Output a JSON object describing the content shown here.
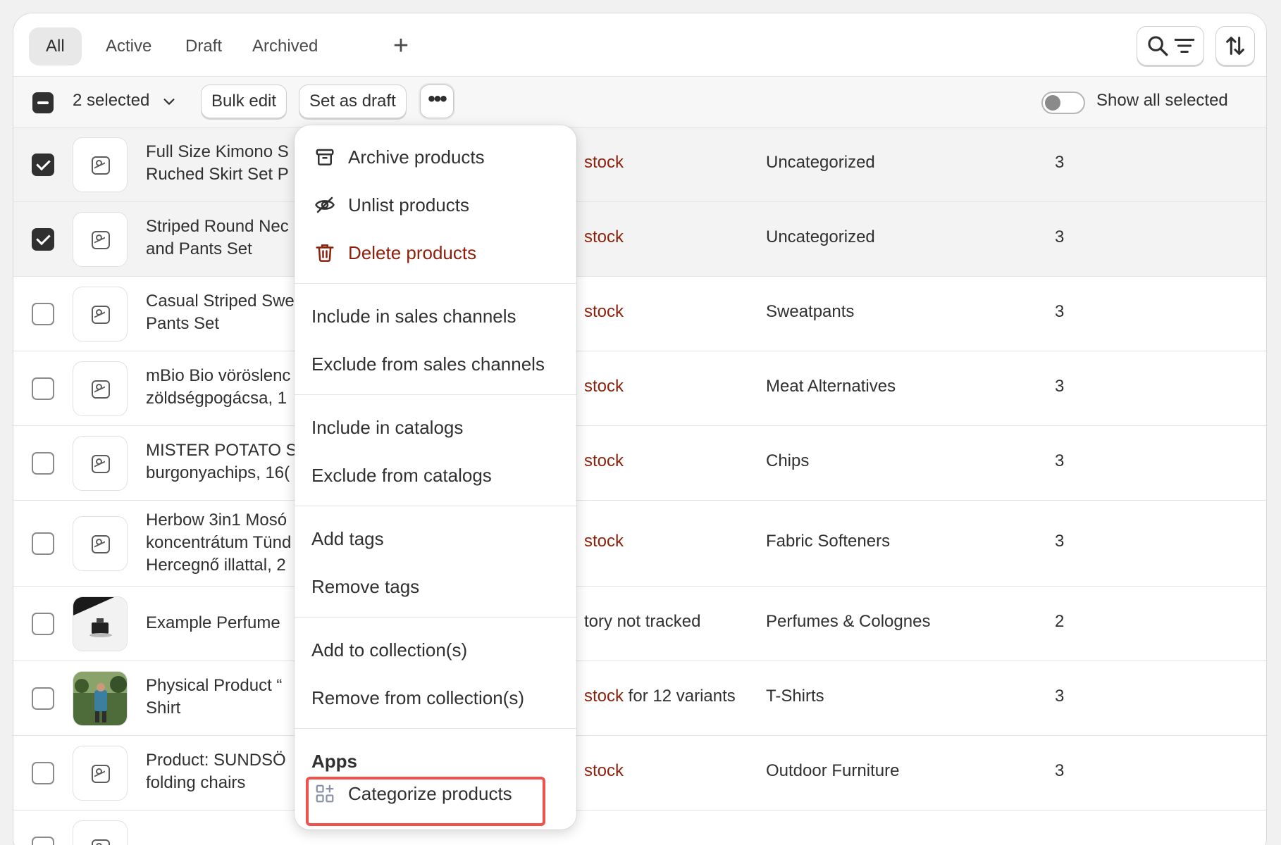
{
  "tabs": [
    {
      "label": "All"
    },
    {
      "label": "Active"
    },
    {
      "label": "Draft"
    },
    {
      "label": "Archived"
    }
  ],
  "tab_add_label": "+",
  "bulk_bar": {
    "selected_label": "2 selected",
    "bulk_edit": "Bulk edit",
    "set_as_draft": "Set as draft",
    "more": "•••",
    "show_all_selected": "Show all selected"
  },
  "rows": [
    {
      "name1": "Full Size Kimono S",
      "name2": "Ruched Skirt Set P",
      "name3": "",
      "stock": "stock",
      "stock_extra": "",
      "category": "Uncategorized",
      "vendor": "3",
      "checked": true
    },
    {
      "name1": "Striped Round Nec",
      "name2": "and Pants Set",
      "name3": "",
      "stock": "stock",
      "stock_extra": "",
      "category": "Uncategorized",
      "vendor": "3",
      "checked": true
    },
    {
      "name1": "Casual Striped Swe",
      "name2": "Pants Set",
      "name3": "",
      "stock": "stock",
      "stock_extra": "",
      "category": "Sweatpants",
      "vendor": "3",
      "checked": false
    },
    {
      "name1": "mBio Bio vöröslenc",
      "name2": "zöldségpogácsa, 1",
      "name3": "",
      "stock": "stock",
      "stock_extra": "",
      "category": "Meat Alternatives",
      "vendor": "3",
      "checked": false
    },
    {
      "name1": "MISTER POTATO S",
      "name2": "burgonyachips, 16(",
      "name3": "",
      "stock": "stock",
      "stock_extra": "",
      "category": "Chips",
      "vendor": "3",
      "checked": false
    },
    {
      "name1": "Herbow 3in1 Mosó",
      "name2": "koncentrátum Tünd",
      "name3": "Hercegnő illattal, 2",
      "stock": "stock",
      "stock_extra": "",
      "category": "Fabric Softeners",
      "vendor": "3",
      "checked": false
    },
    {
      "name1": "Example Perfume",
      "name2": "",
      "name3": "",
      "stock": "",
      "stock_extra": "tory not tracked",
      "category": "Perfumes & Colognes",
      "vendor": "2",
      "checked": false
    },
    {
      "name1": "Physical Product “",
      "name2": "Shirt",
      "name3": "",
      "stock": "stock",
      "stock_extra": " for 12 variants",
      "category": "T-Shirts",
      "vendor": "3",
      "checked": false
    },
    {
      "name1": "Product: SUNDSÖ",
      "name2": "folding chairs",
      "name3": "",
      "stock": "stock",
      "stock_extra": "",
      "category": "Outdoor Furniture",
      "vendor": "3",
      "checked": false
    }
  ],
  "menu": {
    "archive": "Archive products",
    "unlist": "Unlist products",
    "delete": "Delete products",
    "include_channels": "Include in sales channels",
    "exclude_channels": "Exclude from sales channels",
    "include_catalogs": "Include in catalogs",
    "exclude_catalogs": "Exclude from catalogs",
    "add_tags": "Add tags",
    "remove_tags": "Remove tags",
    "add_collection": "Add to collection(s)",
    "remove_collection": "Remove from collection(s)",
    "apps_header": "Apps",
    "categorize": "Categorize products"
  },
  "colors": {
    "danger": "#8e1f0b",
    "highlight": "#f0514a",
    "text": "#303030"
  },
  "icons": [
    "search-icon",
    "filter-icon",
    "sort-icon",
    "archive-icon",
    "eye-off-icon",
    "trash-icon",
    "apps-icon",
    "image-placeholder-icon"
  ]
}
